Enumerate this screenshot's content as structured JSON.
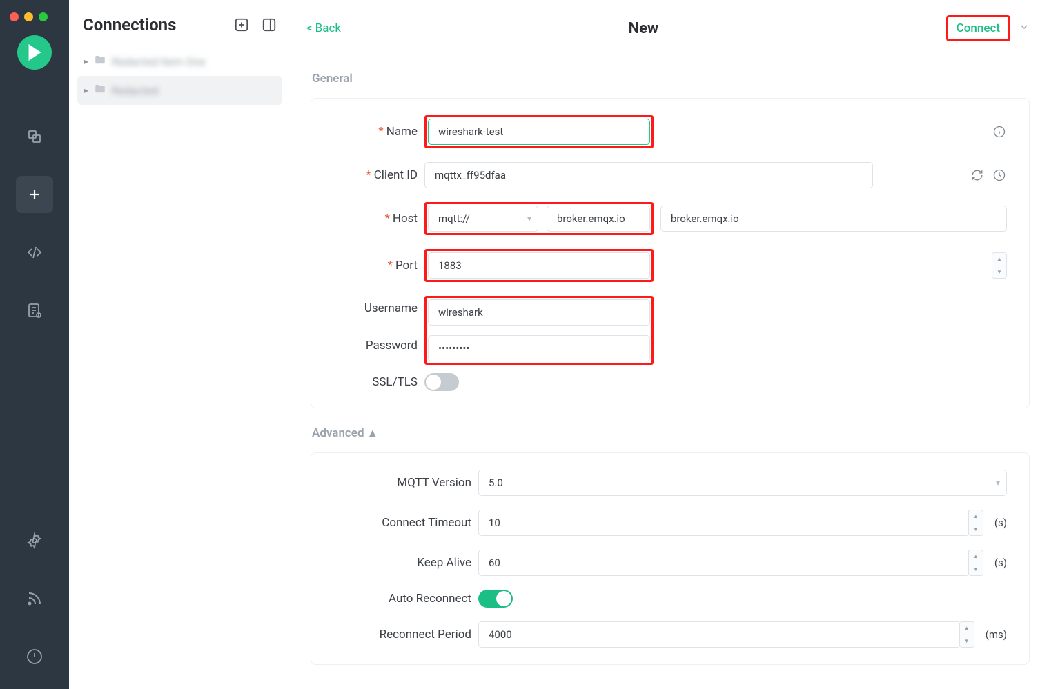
{
  "sidebar": {
    "title": "Connections",
    "items": [
      {
        "label": "Redacted Item One"
      },
      {
        "label": "Redacted"
      }
    ]
  },
  "topbar": {
    "back": "Back",
    "title": "New",
    "connect": "Connect"
  },
  "general": {
    "heading": "General",
    "name_label": "Name",
    "name_value": "wireshark-test",
    "client_id_label": "Client ID",
    "client_id_value": "mqttx_ff95dfaa",
    "host_label": "Host",
    "protocol_value": "mqtt://",
    "host_value": "broker.emqx.io",
    "port_label": "Port",
    "port_value": "1883",
    "username_label": "Username",
    "username_value": "wireshark",
    "password_label": "Password",
    "password_value": "•••••••••",
    "ssl_label": "SSL/TLS"
  },
  "advanced": {
    "heading": "Advanced",
    "mqtt_version_label": "MQTT Version",
    "mqtt_version_value": "5.0",
    "connect_timeout_label": "Connect Timeout",
    "connect_timeout_value": "10",
    "timeout_unit": "(s)",
    "keep_alive_label": "Keep Alive",
    "keep_alive_value": "60",
    "keep_alive_unit": "(s)",
    "auto_reconnect_label": "Auto Reconnect",
    "reconnect_period_label": "Reconnect Period",
    "reconnect_period_value": "4000",
    "reconnect_period_unit": "(ms)"
  }
}
